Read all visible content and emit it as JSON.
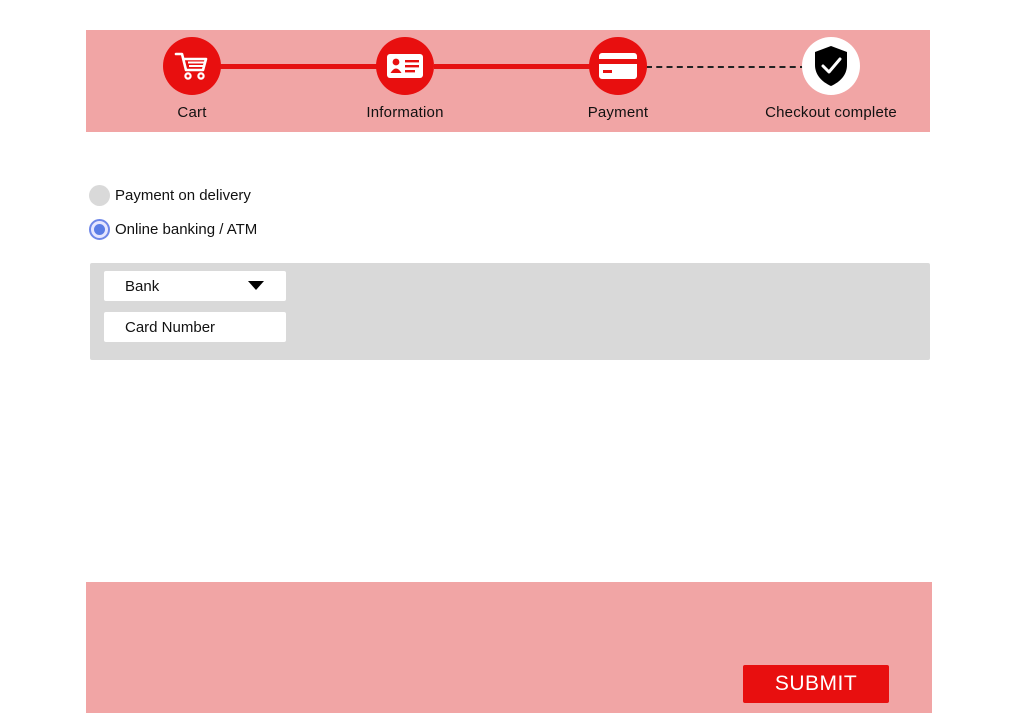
{
  "stepper": {
    "steps": [
      {
        "label": "Cart",
        "icon": "cart-icon",
        "state": "completed"
      },
      {
        "label": "Information",
        "icon": "id-card-icon",
        "state": "completed"
      },
      {
        "label": "Payment",
        "icon": "credit-card-icon",
        "state": "current"
      },
      {
        "label": "Checkout complete",
        "icon": "shield-check-icon",
        "state": "pending"
      }
    ],
    "accent_color": "#e80f0f",
    "background_color": "#f1a5a5"
  },
  "payment_options": [
    {
      "label": "Payment on delivery",
      "selected": false
    },
    {
      "label": "Online banking / ATM",
      "selected": true
    }
  ],
  "bank_form": {
    "bank_select_value": "Bank",
    "card_number_placeholder": "Card Number"
  },
  "footer": {
    "submit_label": "SUBMIT"
  }
}
